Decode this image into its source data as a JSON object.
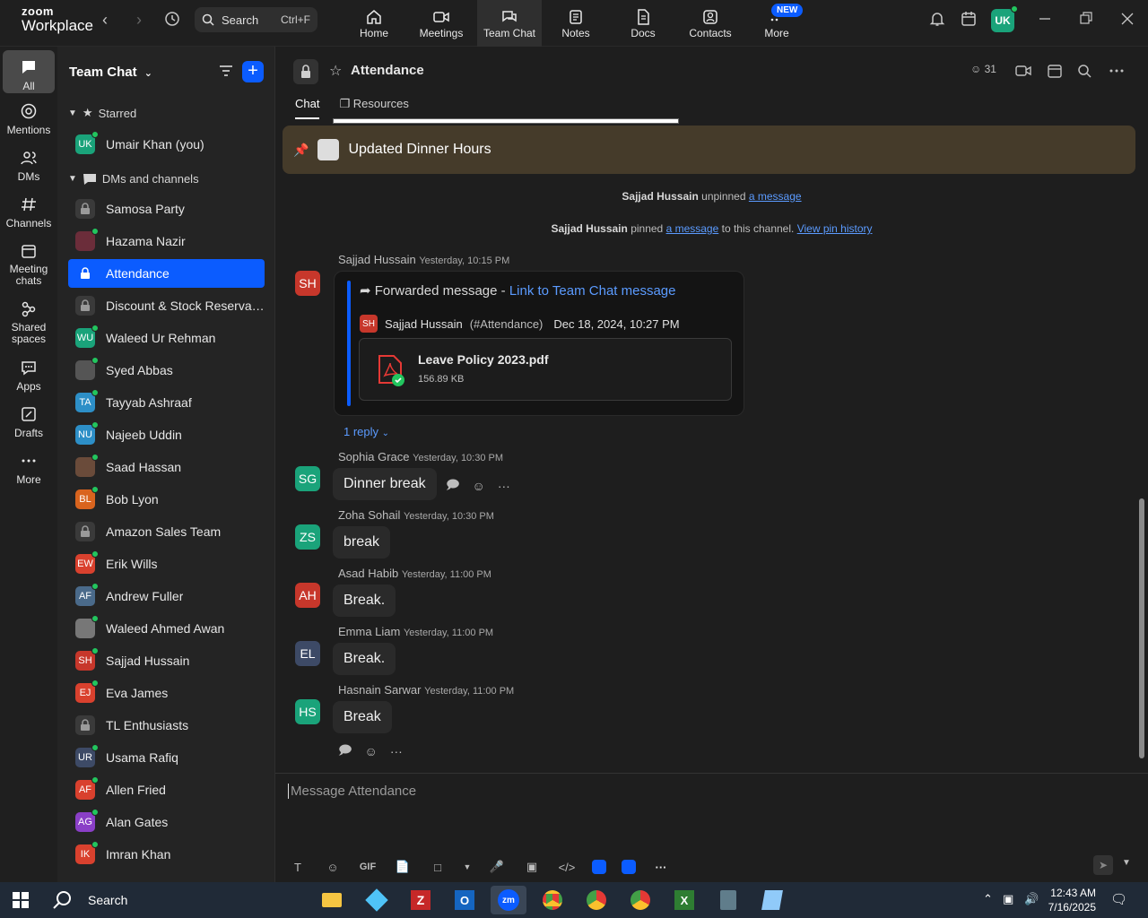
{
  "app": {
    "logo_line1": "zoom",
    "logo_line2": "Workplace",
    "search_placeholder": "Search",
    "search_shortcut": "Ctrl+F",
    "user_initials": "UK",
    "new_badge": "NEW"
  },
  "nav_tabs": [
    {
      "label": "Home"
    },
    {
      "label": "Meetings"
    },
    {
      "label": "Team Chat"
    },
    {
      "label": "Notes"
    },
    {
      "label": "Docs"
    },
    {
      "label": "Contacts"
    },
    {
      "label": "More"
    }
  ],
  "rail": [
    {
      "label": "All"
    },
    {
      "label": "Mentions"
    },
    {
      "label": "DMs"
    },
    {
      "label": "Channels"
    },
    {
      "label": "Meeting chats"
    },
    {
      "label": "Shared spaces"
    },
    {
      "label": "Apps"
    },
    {
      "label": "Drafts"
    },
    {
      "label": "More"
    }
  ],
  "sidebar": {
    "title": "Team Chat",
    "starred_label": "Starred",
    "dms_label": "DMs and channels",
    "starred_item": {
      "initials": "UK",
      "name": "Umair Khan (you)",
      "color": "#1aa37a"
    },
    "items": [
      {
        "initials": "",
        "name": "Samosa Party",
        "color": "#3a3a3a"
      },
      {
        "initials": "",
        "name": "Hazama Nazir",
        "color": "#6b2d3a"
      },
      {
        "initials": "",
        "name": "Attendance",
        "color": "#0b5cff"
      },
      {
        "initials": "",
        "name": "Discount & Stock Reservati...",
        "color": "#3a3a3a"
      },
      {
        "initials": "WU",
        "name": "Waleed Ur Rehman",
        "color": "#1aa37a"
      },
      {
        "initials": "",
        "name": "Syed Abbas",
        "color": "#555555"
      },
      {
        "initials": "TA",
        "name": "Tayyab Ashraaf",
        "color": "#2d8fc7"
      },
      {
        "initials": "NU",
        "name": "Najeeb Uddin",
        "color": "#2d8fc7"
      },
      {
        "initials": "",
        "name": "Saad Hassan",
        "color": "#6a4b3a"
      },
      {
        "initials": "BL",
        "name": "Bob Lyon",
        "color": "#d9641e"
      },
      {
        "initials": "",
        "name": "Amazon Sales Team",
        "color": "#3a3a3a"
      },
      {
        "initials": "EW",
        "name": "Erik Wills",
        "color": "#d9412e"
      },
      {
        "initials": "AF",
        "name": "Andrew Fuller",
        "color": "#4a6a8a"
      },
      {
        "initials": "",
        "name": "Waleed Ahmed Awan",
        "color": "#777777"
      },
      {
        "initials": "SH",
        "name": "Sajjad Hussain",
        "color": "#c7372b"
      },
      {
        "initials": "EJ",
        "name": "Eva James",
        "color": "#d9412e"
      },
      {
        "initials": "",
        "name": "TL Enthusiasts",
        "color": "#3a3a3a"
      },
      {
        "initials": "UR",
        "name": "Usama Rafiq",
        "color": "#3d4a66"
      },
      {
        "initials": "AF",
        "name": "Allen Fried",
        "color": "#d9412e"
      },
      {
        "initials": "AG",
        "name": "Alan Gates",
        "color": "#8a3fc7"
      },
      {
        "initials": "IK",
        "name": "Imran Khan",
        "color": "#d9412e"
      }
    ]
  },
  "channel": {
    "title": "Attendance",
    "member_count": "31",
    "tab_chat": "Chat",
    "tab_resources": "Resources",
    "pinned_title": "Updated Dinner Hours",
    "sys1_name": "Sajjad Hussain",
    "sys1_text": "unpinned",
    "sys1_link": "a message",
    "sys2_name": "Sajjad Hussain",
    "sys2_text": "pinned",
    "sys2_link": "a message",
    "sys2_tail": "to this channel.",
    "sys2_history": "View pin history"
  },
  "forwarded": {
    "sender": "Sajjad Hussain",
    "time": "Yesterday, 10:15 PM",
    "initials": "SH",
    "header": "Forwarded message",
    "link": "Link to Team Chat message",
    "orig_initials": "SH",
    "orig_sender": "Sajjad Hussain",
    "orig_channel": "(#Attendance)",
    "orig_time": "Dec 18, 2024, 10:27 PM",
    "file_name": "Leave Policy 2023.pdf",
    "file_size": "156.89 KB",
    "reply_label": "1 reply"
  },
  "messages": [
    {
      "initials": "SG",
      "color": "#1aa37a",
      "sender": "Sophia Grace",
      "time": "Yesterday, 10:30 PM",
      "text": "Dinner break"
    },
    {
      "initials": "ZS",
      "color": "#1aa37a",
      "sender": "Zoha Sohail",
      "time": "Yesterday, 10:30 PM",
      "text": "break"
    },
    {
      "initials": "AH",
      "color": "#c7372b",
      "sender": "Asad Habib",
      "time": "Yesterday, 11:00 PM",
      "text": "Break."
    },
    {
      "initials": "EL",
      "color": "#3d4a66",
      "sender": "Emma Liam",
      "time": "Yesterday, 11:00 PM",
      "text": "Break."
    },
    {
      "initials": "HS",
      "color": "#1aa37a",
      "sender": "Hasnain Sarwar",
      "time": "Yesterday, 11:00 PM",
      "text": "Break"
    }
  ],
  "composer": {
    "placeholder": "Message Attendance",
    "gif_label": "GIF"
  },
  "taskbar": {
    "search_label": "Search",
    "time": "12:43 AM",
    "date": "7/16/2025"
  }
}
